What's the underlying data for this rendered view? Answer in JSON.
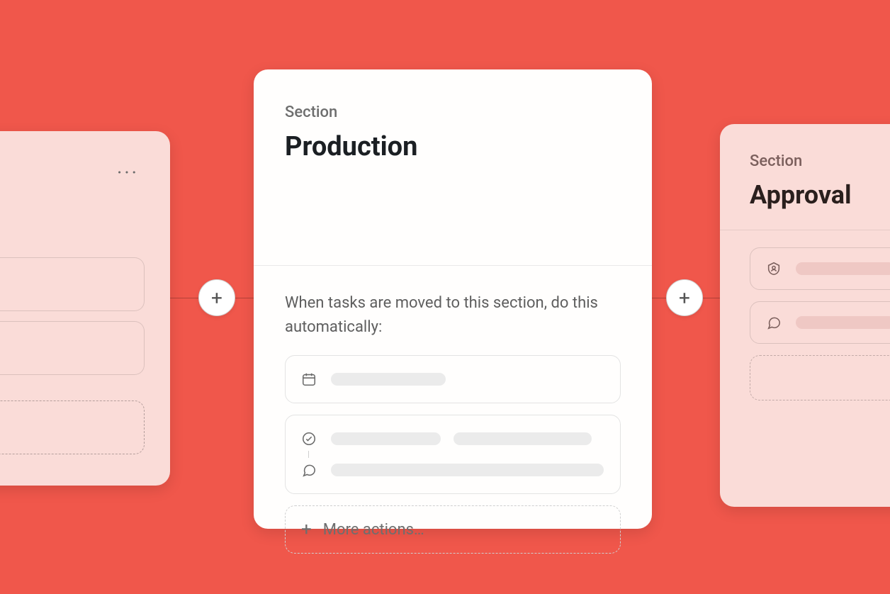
{
  "left": {
    "menu_icon": "ellipsis-icon"
  },
  "center": {
    "section_label": "Section",
    "section_title": "Production",
    "prompt_text": "When tasks are moved to this section, do this automatically:",
    "more_actions_label": "More actions…",
    "rule1_icon": "calendar-icon",
    "rule2_icon_a": "check-circle-icon",
    "rule2_icon_b": "comment-icon"
  },
  "right": {
    "section_label": "Section",
    "section_title": "Approval",
    "rule1_icon": "assignee-icon",
    "rule2_icon": "comment-icon"
  },
  "colors": {
    "background": "#f0574b",
    "card_pink": "#fadcd8",
    "card_white": "#fffefd"
  }
}
